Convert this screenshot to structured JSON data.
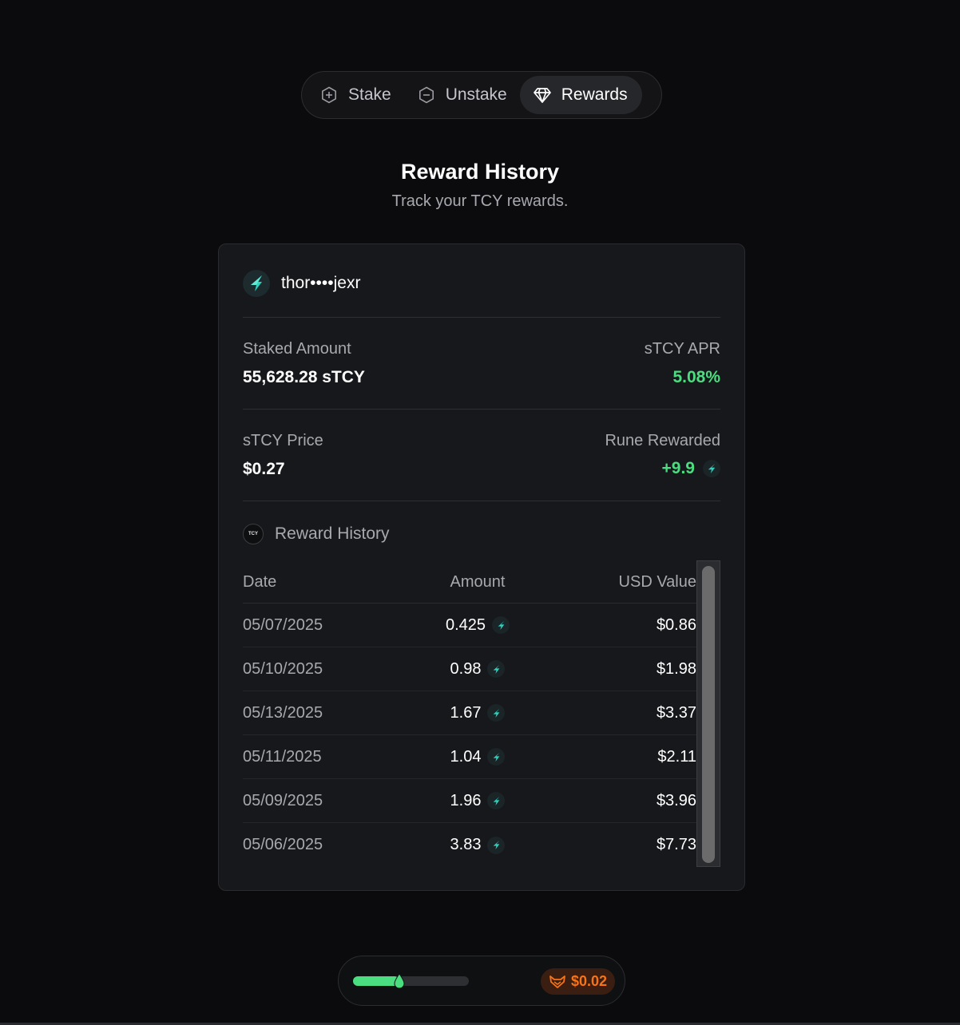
{
  "tabs": [
    {
      "label": "Stake",
      "icon": "plus-circle-icon"
    },
    {
      "label": "Unstake",
      "icon": "minus-circle-icon"
    },
    {
      "label": "Rewards",
      "icon": "gem-icon",
      "active": true
    }
  ],
  "header": {
    "title": "Reward History",
    "subtitle": "Track your TCY rewards."
  },
  "card": {
    "address": "thor••••jexr",
    "staked_amount_label": "Staked Amount",
    "staked_amount_value": "55,628.28 sTCY",
    "apr_label": "sTCY APR",
    "apr_value": "5.08%",
    "price_label": "sTCY Price",
    "price_value": "$0.27",
    "rune_rewarded_label": "Rune Rewarded",
    "rune_rewarded_value": "+9.9",
    "history_label": "Reward History",
    "tcy_badge": "TCY"
  },
  "table": {
    "headers": {
      "date": "Date",
      "amount": "Amount",
      "usd": "USD Value"
    },
    "rows": [
      {
        "date": "05/07/2025",
        "amount": "0.425",
        "usd": "$0.86"
      },
      {
        "date": "05/10/2025",
        "amount": "0.98",
        "usd": "$1.98"
      },
      {
        "date": "05/13/2025",
        "amount": "1.67",
        "usd": "$3.37"
      },
      {
        "date": "05/11/2025",
        "amount": "1.04",
        "usd": "$2.11"
      },
      {
        "date": "05/09/2025",
        "amount": "1.96",
        "usd": "$3.96"
      },
      {
        "date": "05/06/2025",
        "amount": "3.83",
        "usd": "$7.73"
      }
    ]
  },
  "footer": {
    "gas_level": 0.4,
    "price": "$0.02"
  },
  "colors": {
    "accent_green": "#4ade80",
    "rune_teal": "#2dd4bf",
    "orange": "#f97316"
  }
}
